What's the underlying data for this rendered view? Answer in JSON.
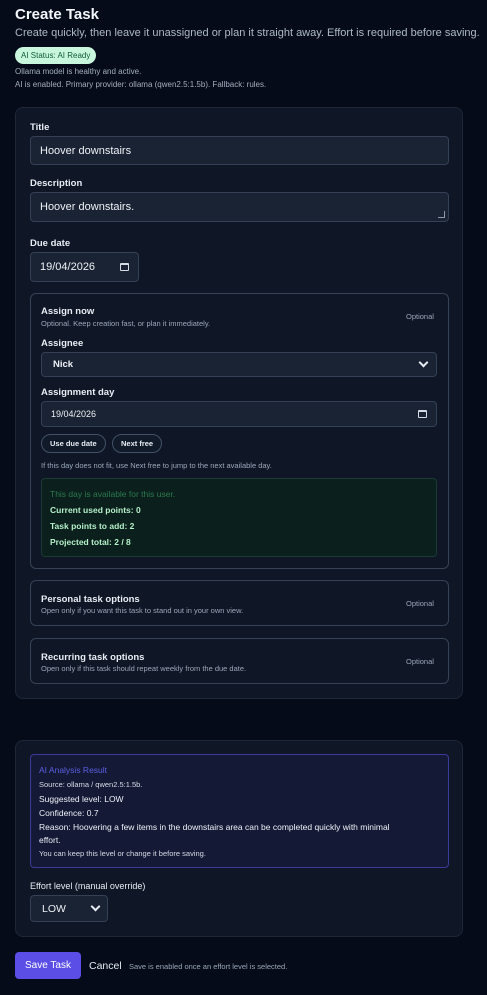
{
  "header": {
    "title": "Create Task",
    "subtitle": "Create quickly, then leave it unassigned or plan it straight away. Effort is required before saving.",
    "ai_status_badge": "AI Status: AI Ready",
    "model_note": "Ollama model is healthy and active.",
    "provider_note": "AI is enabled. Primary provider: ollama (qwen2.5:1.5b). Fallback: rules."
  },
  "form": {
    "title_label": "Title",
    "title_value": "Hoover downstairs",
    "description_label": "Description",
    "description_value": "Hoover downstairs.",
    "due_date_label": "Due date",
    "due_date_value": "19/04/2026"
  },
  "assign": {
    "title": "Assign now",
    "description": "Optional. Keep creation fast, or plan it immediately.",
    "optional_label": "Optional",
    "assignee_label": "Assignee",
    "assignee_value": "Nick",
    "assignment_day_label": "Assignment day",
    "assignment_day_value": "19/04/2026",
    "use_due_date_label": "Use due date",
    "next_free_label": "Next free",
    "hint": "If this day does not fit, use Next free to jump to the next available day.",
    "availability": {
      "status": "This day is available for this user.",
      "current_used": "Current used points: 0",
      "points_to_add": "Task points to add: 2",
      "projected_total": "Projected total: 2 / 8"
    }
  },
  "personal_options": {
    "title": "Personal task options",
    "description": "Open only if you want this task to stand out in your own view.",
    "optional_label": "Optional"
  },
  "recurring_options": {
    "title": "Recurring task options",
    "description": "Open only if this task should repeat weekly from the due date.",
    "optional_label": "Optional"
  },
  "ai_analysis": {
    "heading": "AI Analysis Result",
    "source": "Source: ollama / qwen2.5:1.5b.",
    "suggested_level": "Suggested level: LOW",
    "confidence": "Confidence: 0.7",
    "reason_line1": "Reason: Hoovering a few items in the downstairs area can be completed quickly with minimal",
    "reason_line2": "effort.",
    "hint": "You can keep this level or change it before saving.",
    "effort_label": "Effort level (manual override)",
    "effort_value": "LOW"
  },
  "footer": {
    "save_label": "Save Task",
    "cancel_label": "Cancel",
    "note": "Save is enabled once an effort level is selected."
  },
  "colors": {
    "background": "#050b18",
    "card": "#0f1726",
    "accent": "#5b4ee6",
    "ai_badge": "#c9f7de",
    "success_text": "#b4f0c8"
  }
}
